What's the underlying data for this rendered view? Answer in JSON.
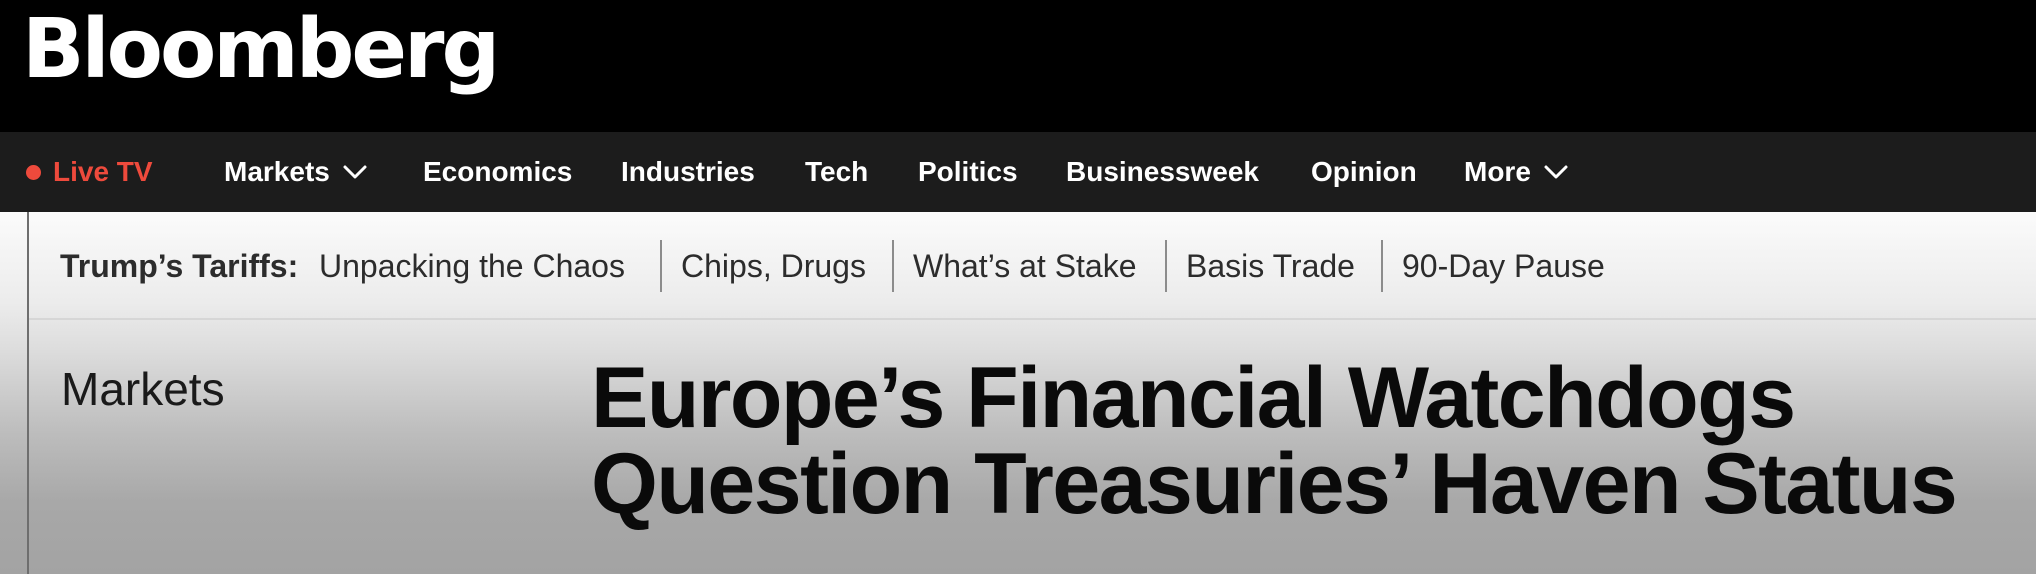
{
  "brand": {
    "logo_text": "Bloomberg"
  },
  "nav": {
    "live_tv": "Live TV",
    "items": [
      {
        "label": "Markets",
        "has_dropdown": true
      },
      {
        "label": "Economics"
      },
      {
        "label": "Industries"
      },
      {
        "label": "Tech"
      },
      {
        "label": "Politics"
      },
      {
        "label": "Businessweek"
      },
      {
        "label": "Opinion"
      },
      {
        "label": "More",
        "has_dropdown": true
      }
    ]
  },
  "topics": {
    "lead": "Trump’s Tariffs:",
    "items": [
      "Unpacking the Chaos",
      "Chips, Drugs",
      "What’s at Stake",
      "Basis Trade",
      "90-Day Pause"
    ]
  },
  "article": {
    "section": "Markets",
    "headline_line1": "Europe’s Financial Watchdogs",
    "headline_line2": "Question Treasuries’ Haven Status"
  },
  "colors": {
    "live_accent": "#ee4a3c",
    "nav_background": "#1c1c1c",
    "header_background": "#000000"
  },
  "icons": {
    "live_indicator": "live-dot-icon",
    "dropdown": "chevron-down-icon"
  }
}
